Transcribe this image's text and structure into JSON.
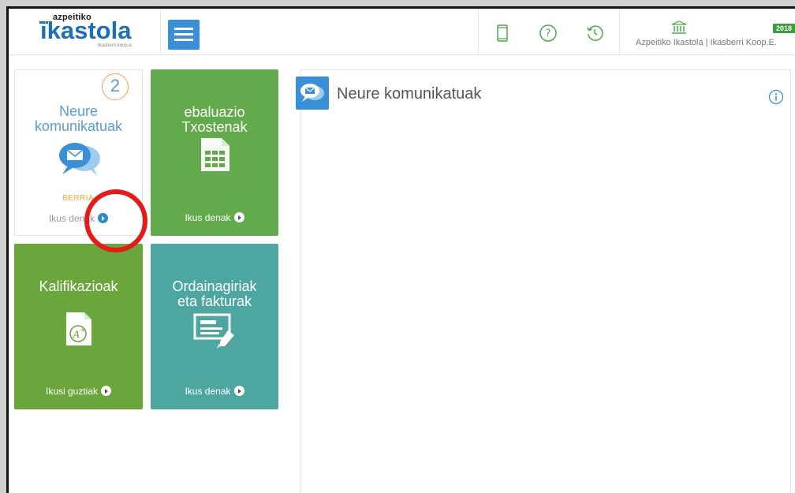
{
  "header": {
    "logo_top": "azpeitiko",
    "logo_main": "ikastola",
    "logo_sub": "Ikasberri koop.e.",
    "menu_icon": "hamburger-icon",
    "icons": [
      "mobile-icon",
      "help-icon",
      "history-icon"
    ],
    "institution_icon": "institution-icon",
    "institution_name": "Azpeitiko Ikastola | Ikasberri Koop.E.",
    "year": "2018"
  },
  "tiles": [
    {
      "title_line1": "Neure",
      "title_line2": "komunikatuak",
      "badge": "2",
      "status": "BERRIA",
      "link": "Ikus denak",
      "icon": "messages-icon"
    },
    {
      "title_line1": "ebaluazio",
      "title_line2": "Txostenak",
      "link": "Ikus denak",
      "icon": "report-icon"
    },
    {
      "title_line1": "Kalifikazioak",
      "link": "Ikusi guztiak",
      "icon": "grade-icon"
    },
    {
      "title_line1": "Ordainagiriak",
      "title_line2": "eta fakturak",
      "link": "Ikus denak",
      "icon": "invoice-icon"
    }
  ],
  "panel": {
    "title": "Neure komunikatuak",
    "icon": "messages-icon",
    "info_icon": "info-icon"
  },
  "colors": {
    "brand_blue": "#1d6fb8",
    "green": "#62aa4b",
    "olive_green": "#6aa63c",
    "teal": "#4ea6a1",
    "annotation_red": "#e31b1b"
  }
}
